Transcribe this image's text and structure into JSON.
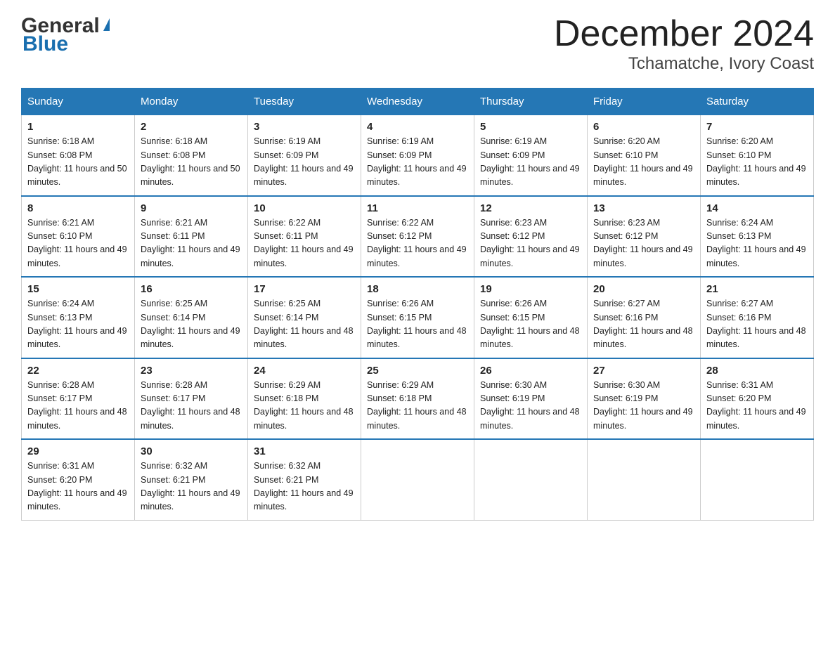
{
  "header": {
    "logo_general": "General",
    "logo_blue": "Blue",
    "month_title": "December 2024",
    "location": "Tchamatche, Ivory Coast"
  },
  "weekdays": [
    "Sunday",
    "Monday",
    "Tuesday",
    "Wednesday",
    "Thursday",
    "Friday",
    "Saturday"
  ],
  "weeks": [
    [
      {
        "day": "1",
        "sunrise": "6:18 AM",
        "sunset": "6:08 PM",
        "daylight": "11 hours and 50 minutes."
      },
      {
        "day": "2",
        "sunrise": "6:18 AM",
        "sunset": "6:08 PM",
        "daylight": "11 hours and 50 minutes."
      },
      {
        "day": "3",
        "sunrise": "6:19 AM",
        "sunset": "6:09 PM",
        "daylight": "11 hours and 49 minutes."
      },
      {
        "day": "4",
        "sunrise": "6:19 AM",
        "sunset": "6:09 PM",
        "daylight": "11 hours and 49 minutes."
      },
      {
        "day": "5",
        "sunrise": "6:19 AM",
        "sunset": "6:09 PM",
        "daylight": "11 hours and 49 minutes."
      },
      {
        "day": "6",
        "sunrise": "6:20 AM",
        "sunset": "6:10 PM",
        "daylight": "11 hours and 49 minutes."
      },
      {
        "day": "7",
        "sunrise": "6:20 AM",
        "sunset": "6:10 PM",
        "daylight": "11 hours and 49 minutes."
      }
    ],
    [
      {
        "day": "8",
        "sunrise": "6:21 AM",
        "sunset": "6:10 PM",
        "daylight": "11 hours and 49 minutes."
      },
      {
        "day": "9",
        "sunrise": "6:21 AM",
        "sunset": "6:11 PM",
        "daylight": "11 hours and 49 minutes."
      },
      {
        "day": "10",
        "sunrise": "6:22 AM",
        "sunset": "6:11 PM",
        "daylight": "11 hours and 49 minutes."
      },
      {
        "day": "11",
        "sunrise": "6:22 AM",
        "sunset": "6:12 PM",
        "daylight": "11 hours and 49 minutes."
      },
      {
        "day": "12",
        "sunrise": "6:23 AM",
        "sunset": "6:12 PM",
        "daylight": "11 hours and 49 minutes."
      },
      {
        "day": "13",
        "sunrise": "6:23 AM",
        "sunset": "6:12 PM",
        "daylight": "11 hours and 49 minutes."
      },
      {
        "day": "14",
        "sunrise": "6:24 AM",
        "sunset": "6:13 PM",
        "daylight": "11 hours and 49 minutes."
      }
    ],
    [
      {
        "day": "15",
        "sunrise": "6:24 AM",
        "sunset": "6:13 PM",
        "daylight": "11 hours and 49 minutes."
      },
      {
        "day": "16",
        "sunrise": "6:25 AM",
        "sunset": "6:14 PM",
        "daylight": "11 hours and 49 minutes."
      },
      {
        "day": "17",
        "sunrise": "6:25 AM",
        "sunset": "6:14 PM",
        "daylight": "11 hours and 48 minutes."
      },
      {
        "day": "18",
        "sunrise": "6:26 AM",
        "sunset": "6:15 PM",
        "daylight": "11 hours and 48 minutes."
      },
      {
        "day": "19",
        "sunrise": "6:26 AM",
        "sunset": "6:15 PM",
        "daylight": "11 hours and 48 minutes."
      },
      {
        "day": "20",
        "sunrise": "6:27 AM",
        "sunset": "6:16 PM",
        "daylight": "11 hours and 48 minutes."
      },
      {
        "day": "21",
        "sunrise": "6:27 AM",
        "sunset": "6:16 PM",
        "daylight": "11 hours and 48 minutes."
      }
    ],
    [
      {
        "day": "22",
        "sunrise": "6:28 AM",
        "sunset": "6:17 PM",
        "daylight": "11 hours and 48 minutes."
      },
      {
        "day": "23",
        "sunrise": "6:28 AM",
        "sunset": "6:17 PM",
        "daylight": "11 hours and 48 minutes."
      },
      {
        "day": "24",
        "sunrise": "6:29 AM",
        "sunset": "6:18 PM",
        "daylight": "11 hours and 48 minutes."
      },
      {
        "day": "25",
        "sunrise": "6:29 AM",
        "sunset": "6:18 PM",
        "daylight": "11 hours and 48 minutes."
      },
      {
        "day": "26",
        "sunrise": "6:30 AM",
        "sunset": "6:19 PM",
        "daylight": "11 hours and 48 minutes."
      },
      {
        "day": "27",
        "sunrise": "6:30 AM",
        "sunset": "6:19 PM",
        "daylight": "11 hours and 49 minutes."
      },
      {
        "day": "28",
        "sunrise": "6:31 AM",
        "sunset": "6:20 PM",
        "daylight": "11 hours and 49 minutes."
      }
    ],
    [
      {
        "day": "29",
        "sunrise": "6:31 AM",
        "sunset": "6:20 PM",
        "daylight": "11 hours and 49 minutes."
      },
      {
        "day": "30",
        "sunrise": "6:32 AM",
        "sunset": "6:21 PM",
        "daylight": "11 hours and 49 minutes."
      },
      {
        "day": "31",
        "sunrise": "6:32 AM",
        "sunset": "6:21 PM",
        "daylight": "11 hours and 49 minutes."
      },
      null,
      null,
      null,
      null
    ]
  ]
}
